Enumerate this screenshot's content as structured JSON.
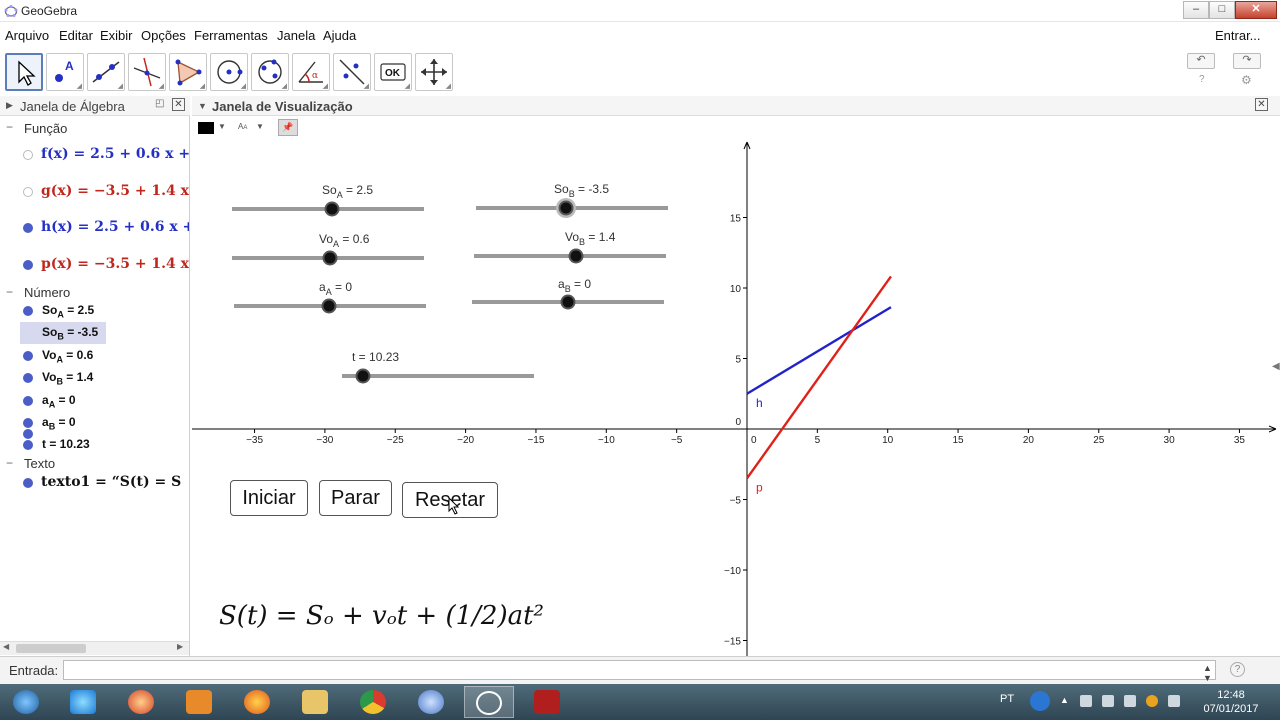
{
  "window": {
    "title": "GeoGebra",
    "min": "–",
    "max": "□",
    "close": "✕"
  },
  "menu": [
    "Arquivo",
    "Editar",
    "Exibir",
    "Opções",
    "Ferramentas",
    "Janela",
    "Ajuda"
  ],
  "login": "Entrar...",
  "toolbar": {
    "ok_label": "OK",
    "undo": "↶",
    "redo": "↷"
  },
  "algebra": {
    "title": "Janela de Álgebra",
    "categories": {
      "funcao": "Função",
      "numero": "Número",
      "texto": "Texto"
    },
    "functions": [
      {
        "name": "f(x)",
        "expr": "f(x)  =  2.5 + 0.6 x + ",
        "visible": false,
        "color": "#2430c4"
      },
      {
        "name": "g(x)",
        "expr": "g(x)  =  −3.5 + 1.4 x",
        "visible": false,
        "color": "#c0261c"
      },
      {
        "name": "h(x)",
        "expr": "h(x)  =  2.5 + 0.6 x + ",
        "visible": true,
        "color": "#2430c4"
      },
      {
        "name": "p(x)",
        "expr": "p(x)  =  −3.5 + 1.4 x",
        "visible": true,
        "color": "#c0261c"
      }
    ],
    "numbers": [
      {
        "base": "So",
        "sub": "A",
        "value": "= 2.5"
      },
      {
        "base": "So",
        "sub": "B",
        "value": "= -3.5"
      },
      {
        "base": "Vo",
        "sub": "A",
        "value": "= 0.6"
      },
      {
        "base": "Vo",
        "sub": "B",
        "value": "= 1.4"
      },
      {
        "base": "a",
        "sub": "A",
        "value": "= 0"
      },
      {
        "base": "a",
        "sub": "B",
        "value": "= 0"
      },
      {
        "base": "t",
        "sub": "",
        "value": "= 10.23"
      }
    ],
    "text": "texto1  =  “S(t) = S"
  },
  "graphics": {
    "title": "Janela de Visualização",
    "sliders": [
      {
        "base": "So",
        "sub": "A",
        "value": "2.5"
      },
      {
        "base": "So",
        "sub": "B",
        "value": "-3.5"
      },
      {
        "base": "Vo",
        "sub": "A",
        "value": "0.6"
      },
      {
        "base": "Vo",
        "sub": "B",
        "value": "1.4"
      },
      {
        "base": "a",
        "sub": "A",
        "value": "0"
      },
      {
        "base": "a",
        "sub": "B",
        "value": "0"
      },
      {
        "base": "t",
        "sub": "",
        "value": "10.23"
      }
    ],
    "slider_fraction": [
      0.5,
      0.5,
      0.5,
      0.5,
      0.5,
      0.5,
      0.1
    ],
    "buttons": {
      "iniciar": "Iniciar",
      "parar": "Parar",
      "resetar": "Resetar"
    },
    "formula": "S(t) = Sₒ + vₒt + (1/2)at²",
    "x_ticks": [
      -35,
      -30,
      -25,
      -20,
      -15,
      -10,
      -5,
      0,
      5,
      10,
      15,
      20,
      25,
      30,
      35
    ],
    "y_ticks": [
      -15,
      -10,
      -5,
      0,
      5,
      10,
      15
    ],
    "axis_colors": {
      "axis": "#000000",
      "h": "#2222cc",
      "p": "#e0211a"
    }
  },
  "chart_data": {
    "type": "line",
    "title": "",
    "xlabel": "",
    "ylabel": "",
    "xlim": [
      -39,
      37
    ],
    "ylim": [
      -16,
      20
    ],
    "grid": false,
    "series": [
      {
        "name": "h",
        "x": [
          0,
          10.23
        ],
        "y": [
          2.5,
          8.638
        ]
      },
      {
        "name": "p",
        "x": [
          0,
          10.23
        ],
        "y": [
          -3.5,
          10.822
        ]
      }
    ]
  },
  "input": {
    "label": "Entrada:"
  },
  "taskbar": {
    "lang": "PT",
    "time": "12:48",
    "date": "07/01/2017"
  }
}
